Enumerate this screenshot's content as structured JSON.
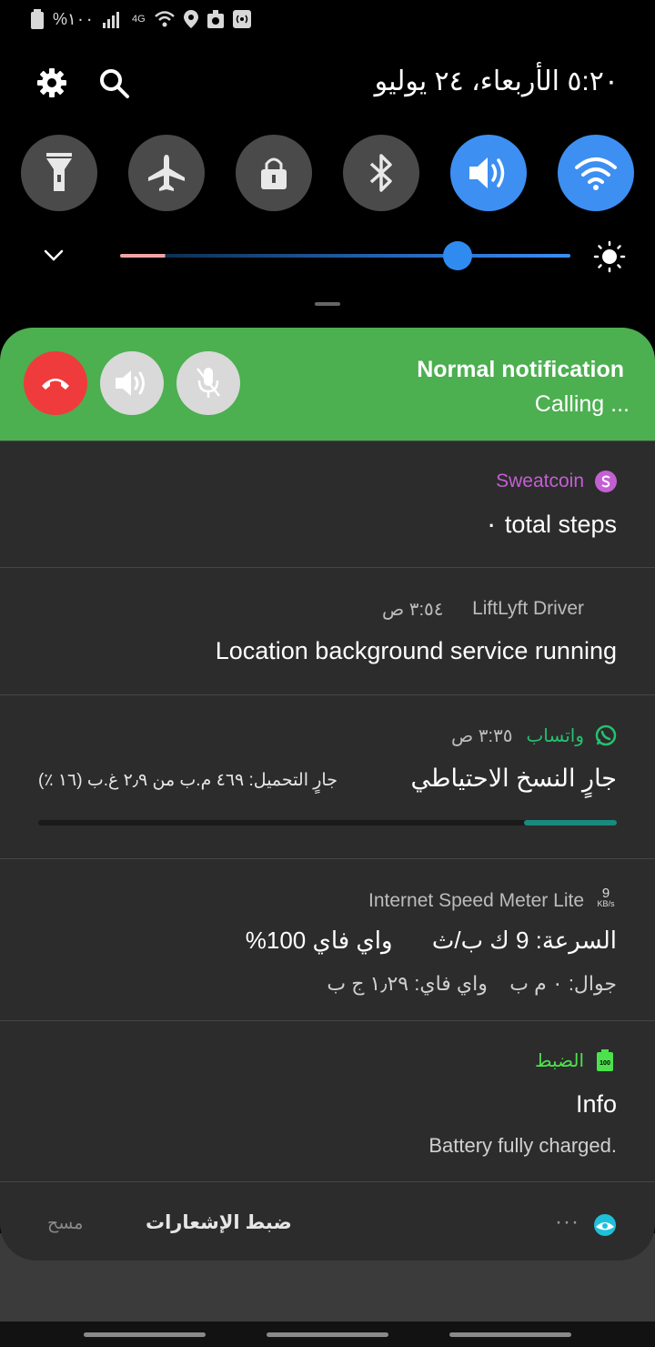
{
  "status_bar": {
    "battery_text": "%١٠٠",
    "network_text": "4G",
    "icons": [
      "battery-icon",
      "signal-icon",
      "4g-icon",
      "wifi-icon",
      "location-icon",
      "recycle-icon",
      "hotspot-icon"
    ]
  },
  "header": {
    "datetime": "٥:٢٠  الأربعاء، ٢٤ يوليو",
    "icons": [
      "gear-icon",
      "search-icon"
    ]
  },
  "quick_settings": [
    {
      "name": "flashlight",
      "icon": "flashlight-icon",
      "on": false
    },
    {
      "name": "airplane",
      "icon": "airplane-icon",
      "on": false
    },
    {
      "name": "lock",
      "icon": "lock-icon",
      "on": false
    },
    {
      "name": "bluetooth",
      "icon": "bluetooth-icon",
      "on": false
    },
    {
      "name": "sound",
      "icon": "volume-icon",
      "on": true
    },
    {
      "name": "wifi",
      "icon": "wifi-icon",
      "on": true
    }
  ],
  "brightness": {
    "level": 0.75
  },
  "call": {
    "title": "Normal notification",
    "status": "Calling ..."
  },
  "notifications": {
    "sweatcoin": {
      "app": "Sweatcoin",
      "main": "٠ total steps"
    },
    "liftlyft": {
      "app": "LiftLyft Driver",
      "time": "٣:٥٤ ص",
      "main": "Location background service running"
    },
    "whatsapp": {
      "app": "واتساب",
      "time": "٣:٣٥ ص",
      "main": "جارٍ النسخ الاحتياطي",
      "detail": "جارٍ التحميل: ٤٦٩ م.ب من ٢٫٩ غ.ب (١٦ ٪)",
      "progress": 0.16
    },
    "speedmeter": {
      "app": "Internet Speed Meter Lite",
      "badge_value": "9",
      "badge_unit": "KB/s",
      "main": "السرعة: 9 ك ب/ث      واي فاي 100%",
      "detail": "جوال: ٠ م ب    واي فاي: ١٫٢٩ ج ب"
    },
    "care": {
      "app": "الضبط",
      "badge": "100",
      "main": "Info",
      "detail": "Battery fully charged."
    }
  },
  "footer": {
    "clear": "مسح",
    "settings": "ضبط الإشعارات",
    "dots": "···"
  },
  "colors": {
    "call_green": "#4caf50",
    "accent_blue": "#3d8ff2",
    "sweatcoin_purple": "#c45fd3",
    "whatsapp_green": "#25c16f",
    "care_green": "#4de14d"
  }
}
